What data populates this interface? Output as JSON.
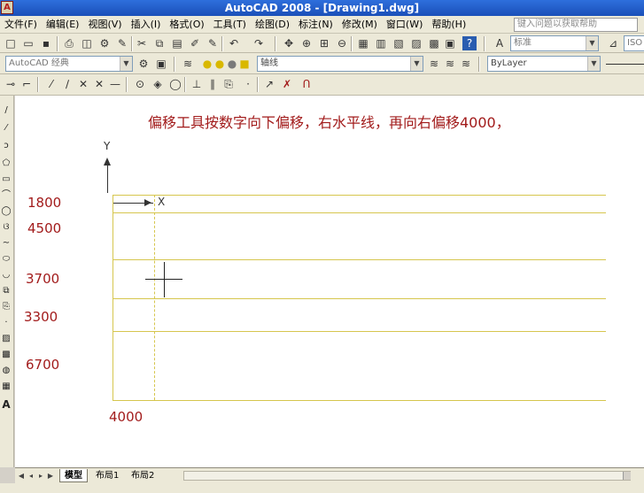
{
  "window": {
    "title": "AutoCAD 2008 - [Drawing1.dwg]"
  },
  "menu": {
    "items": [
      "文件(F)",
      "编辑(E)",
      "视图(V)",
      "插入(I)",
      "格式(O)",
      "工具(T)",
      "绘图(D)",
      "标注(N)",
      "修改(M)",
      "窗口(W)",
      "帮助(H)"
    ],
    "help_placeholder": "键入问题以获取帮助"
  },
  "toolbar": {
    "workspace": "AutoCAD 经典",
    "text_style": "标准",
    "layer": "轴线",
    "linetype": "ByLayer",
    "dim_style": "ISO"
  },
  "canvas": {
    "note": "偏移工具按数字向下偏移，右水平线，再向右偏移4000，",
    "dimensions": [
      "1800",
      "4500",
      "3700",
      "3300",
      "6700"
    ],
    "x_dimension": "4000",
    "ucs": {
      "y_label": "Y",
      "x_label": "X"
    },
    "colors": {
      "grid_line": "#d6c64e",
      "dimension_text": "#a21b1b"
    }
  },
  "layout_tabs": [
    "模型",
    "布局1",
    "布局2"
  ],
  "icons": [
    "save-icon",
    "open-icon",
    "undo-icon",
    "redo-icon",
    "zoom-icon",
    "line-icon",
    "circle-icon",
    "text-icon"
  ]
}
